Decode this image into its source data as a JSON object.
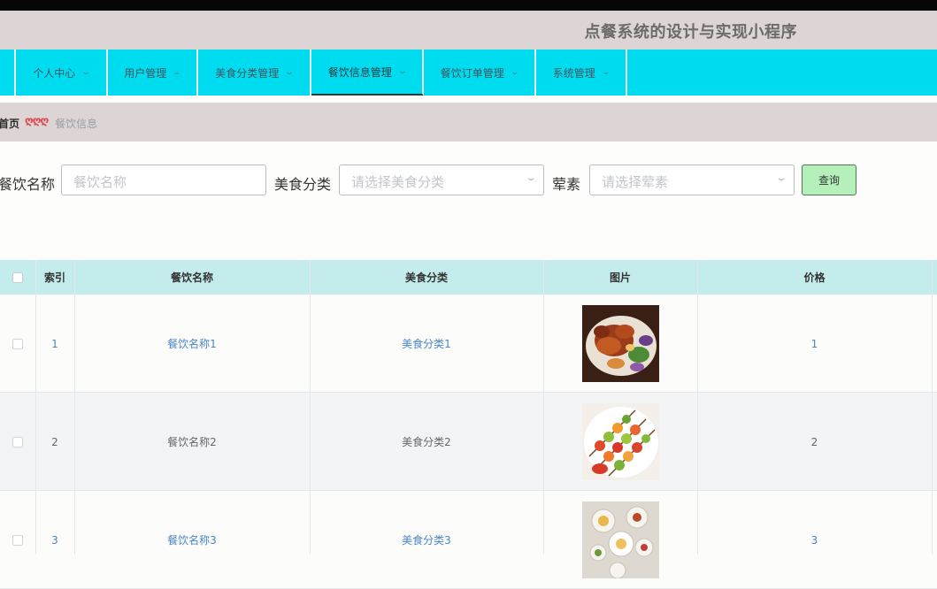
{
  "app": {
    "title": "点餐系统的设计与实现小程序"
  },
  "nav": {
    "items": [
      {
        "label": "个人中心"
      },
      {
        "label": "用户管理"
      },
      {
        "label": "美食分类管理"
      },
      {
        "label": "餐饮信息管理"
      },
      {
        "label": "餐饮订单管理"
      },
      {
        "label": "系统管理"
      }
    ],
    "active_index": 3
  },
  "breadcrumb": {
    "home": "首页",
    "separator": "ღღღ",
    "current": "餐饮信息"
  },
  "search": {
    "name_label": "餐饮名称",
    "name_placeholder": "餐饮名称",
    "category_label": "美食分类",
    "category_placeholder": "请选择美食分类",
    "veg_label": "荤素",
    "veg_placeholder": "请选择荤素",
    "query_button": "查询"
  },
  "table": {
    "columns": [
      "索引",
      "餐饮名称",
      "美食分类",
      "图片",
      "价格"
    ],
    "rows": [
      {
        "index": "1",
        "name": "餐饮名称1",
        "category": "美食分类1",
        "image": "grilled-shrimp-plate",
        "price": "1"
      },
      {
        "index": "2",
        "name": "餐饮名称2",
        "category": "美食分类2",
        "image": "veggie-skewers-plate",
        "price": "2"
      },
      {
        "index": "3",
        "name": "餐饮名称3",
        "category": "美食分类3",
        "image": "breakfast-table-spread",
        "price": "3"
      }
    ]
  },
  "colors": {
    "navbar": "#00dcef",
    "titlebar": "#dcd4d5",
    "table_header": "#c4ecec",
    "link": "#4a86c6",
    "query_button": "#b5f0bb"
  }
}
